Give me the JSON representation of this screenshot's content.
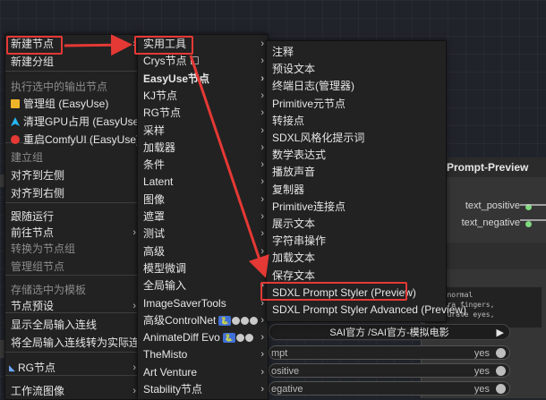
{
  "menu1": {
    "items": [
      {
        "label": "新建节点",
        "submenu": true,
        "disabled": false
      },
      {
        "label": "新建分组",
        "submenu": false,
        "disabled": false
      },
      {
        "label": "执行选中的输出节点",
        "submenu": false,
        "disabled": true
      },
      {
        "label": "管理组 (EasyUse)",
        "submenu": false,
        "disabled": false,
        "icon": "folder-icon"
      },
      {
        "label": "清理GPU占用 (EasyUse)",
        "submenu": false,
        "disabled": false,
        "icon": "rocket-icon"
      },
      {
        "label": "重启ComfyUI (EasyUse)",
        "submenu": false,
        "disabled": false,
        "icon": "restart-icon"
      },
      {
        "label": "建立组",
        "submenu": false,
        "disabled": true
      },
      {
        "label": "对齐到左侧",
        "submenu": false,
        "disabled": false
      },
      {
        "label": "对齐到右侧",
        "submenu": false,
        "disabled": false
      },
      {
        "label": "跟随运行",
        "submenu": false,
        "disabled": false
      },
      {
        "label": "前往节点",
        "submenu": true,
        "disabled": false
      },
      {
        "label": "转换为节点组",
        "submenu": false,
        "disabled": true
      },
      {
        "label": "管理组节点",
        "submenu": false,
        "disabled": true
      },
      {
        "label": "存储选中为模板",
        "submenu": false,
        "disabled": true
      },
      {
        "label": "节点预设",
        "submenu": true,
        "disabled": false
      },
      {
        "label": "显示全局输入连线",
        "submenu": false,
        "disabled": false
      },
      {
        "label": "将全局输入连线转为实际连线",
        "submenu": false,
        "disabled": false
      },
      {
        "label": "RG节点",
        "submenu": true,
        "disabled": false
      },
      {
        "label": "工作流图像",
        "submenu": true,
        "disabled": false
      }
    ]
  },
  "menu2": {
    "items": [
      {
        "label": "实用工具",
        "submenu": true,
        "bold": false
      },
      {
        "label": "Crys节点 ☐",
        "submenu": true,
        "bold": false
      },
      {
        "label": "EasyUse节点",
        "submenu": true,
        "bold": true
      },
      {
        "label": "KJ节点",
        "submenu": true,
        "bold": false
      },
      {
        "label": "RG节点",
        "submenu": true,
        "bold": false
      },
      {
        "label": "采样",
        "submenu": true,
        "bold": false
      },
      {
        "label": "加载器",
        "submenu": true,
        "bold": false
      },
      {
        "label": "条件",
        "submenu": true,
        "bold": false
      },
      {
        "label": "Latent",
        "submenu": true,
        "bold": false
      },
      {
        "label": "图像",
        "submenu": true,
        "bold": false
      },
      {
        "label": "遮罩",
        "submenu": true,
        "bold": false
      },
      {
        "label": "测试",
        "submenu": true,
        "bold": false
      },
      {
        "label": "高级",
        "submenu": true,
        "bold": false
      },
      {
        "label": "模型微调",
        "submenu": true,
        "bold": false
      },
      {
        "label": "全局输入",
        "submenu": true,
        "bold": false
      },
      {
        "label": "ImageSaverTools",
        "submenu": true,
        "bold": false
      },
      {
        "label": "高级ControlNet",
        "submenu": true,
        "bold": false,
        "badges": true
      },
      {
        "label": "AnimateDiff Evo",
        "submenu": true,
        "bold": false,
        "badges": true
      },
      {
        "label": "TheMisto",
        "submenu": true,
        "bold": false
      },
      {
        "label": "Art Venture",
        "submenu": true,
        "bold": false
      },
      {
        "label": "Stability节点",
        "submenu": true,
        "bold": false
      }
    ]
  },
  "menu3": {
    "items": [
      {
        "label": "注释"
      },
      {
        "label": "预设文本"
      },
      {
        "label": "终端日志(管理器)"
      },
      {
        "label": "Primitive元节点"
      },
      {
        "label": "转接点"
      },
      {
        "label": "SDXL风格化提示词"
      },
      {
        "label": "数学表达式"
      },
      {
        "label": "播放声音"
      },
      {
        "label": "复制器"
      },
      {
        "label": "Primitive连接点"
      },
      {
        "label": "展示文本"
      },
      {
        "label": "字符串操作"
      },
      {
        "label": "加载文本"
      },
      {
        "label": "保存文本"
      },
      {
        "label": "SDXL Prompt Styler (Preview)"
      },
      {
        "label": "SDXL Prompt Styler Advanced (Preview)"
      }
    ]
  },
  "node": {
    "title": "Prompt-Preview",
    "outputs": [
      "text_positive",
      "text_negative"
    ],
    "textarea": "y, normal\nextra fingers,\naccurate eyes,",
    "combo": "SAI官方 /SAI官方-模拟电影",
    "widgets": [
      {
        "label": "mpt",
        "value": "yes"
      },
      {
        "label": "ositive",
        "value": "yes"
      },
      {
        "label": "egative",
        "value": "yes"
      }
    ]
  },
  "colors": {
    "highlight": "#e53935",
    "menu_bg": "#222222",
    "text": "#e6e6e6",
    "disabled": "#8c8c8c"
  }
}
